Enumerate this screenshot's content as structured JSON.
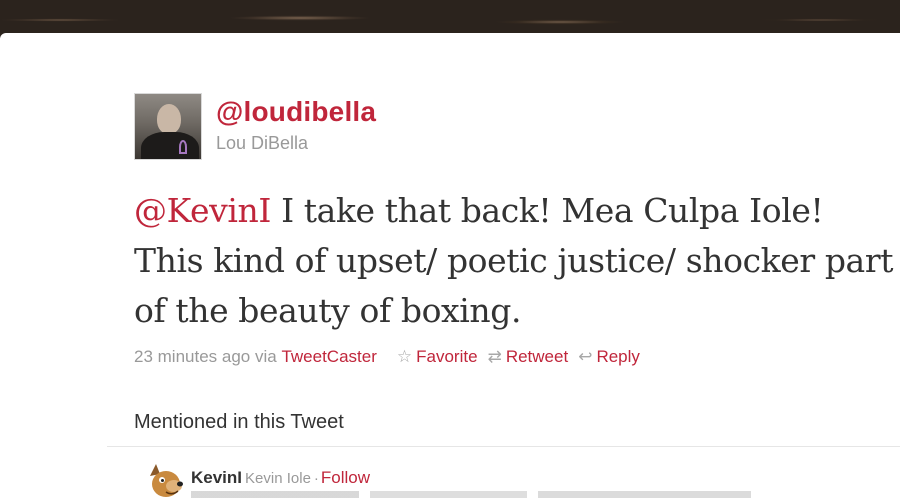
{
  "tweet": {
    "screen_name": "@loudibella",
    "full_name": "Lou DiBella",
    "mention": "@KevinI",
    "text_rest": " I take that back! Mea Culpa Iole! This kind of upset/ poetic justice/ shocker part of the beauty of boxing.",
    "timestamp": "23 minutes ago",
    "via_label": "via",
    "client": "TweetCaster"
  },
  "actions": {
    "favorite_label": "Favorite",
    "retweet_label": "Retweet",
    "reply_label": "Reply"
  },
  "mentioned": {
    "title": "Mentioned in this Tweet",
    "user": {
      "screen_name": "KevinI",
      "name": "Kevin Iole",
      "separator": "·",
      "follow_label": "Follow"
    }
  },
  "icons": {
    "favorite": "star-outline-icon",
    "retweet": "retweet-icon",
    "reply": "reply-arrow-icon"
  },
  "colors": {
    "accent": "#c0263b",
    "muted": "#999999",
    "text": "#333333"
  }
}
